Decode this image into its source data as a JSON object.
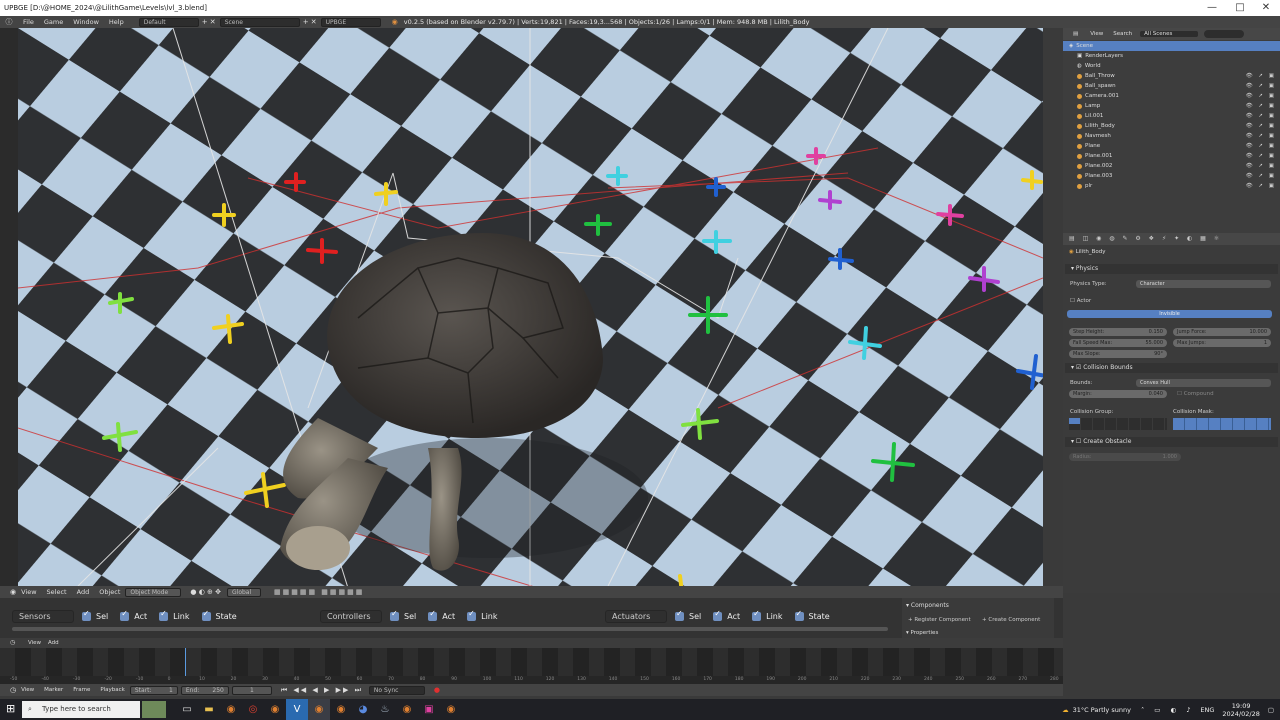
{
  "window": {
    "title": "UPBGE [D:\\@HOME_2024\\@LilithGame\\Levels\\lvl_3.blend]",
    "controls": [
      "—",
      "□",
      "✕"
    ]
  },
  "menubar": {
    "items": [
      "File",
      "Game",
      "Window",
      "Help"
    ],
    "layout_field": "Default",
    "scene_field": "Scene",
    "engine_field": "UPBGE",
    "stats": "v0.2.5 (based on Blender v2.79.7) | Verts:19,821 | Faces:19,3...568 | Objects:1/26 | Lamps:0/1 | Mem: 948.8 MB | Lilith_Body"
  },
  "outliner": {
    "header": [
      "View",
      "Search",
      "All Scenes"
    ],
    "rows": [
      {
        "label": "Scene",
        "selected": true
      },
      {
        "label": "RenderLayers"
      },
      {
        "label": "World"
      },
      {
        "label": "Ball_Throw"
      },
      {
        "label": "Ball_spawn"
      },
      {
        "label": "Camera.001"
      },
      {
        "label": "Lamp"
      },
      {
        "label": "Lil.001"
      },
      {
        "label": "Lilith_Body"
      },
      {
        "label": "Navmesh"
      },
      {
        "label": "Plane"
      },
      {
        "label": "Plane.001"
      },
      {
        "label": "Plane.002"
      },
      {
        "label": "Plane.003"
      },
      {
        "label": "plr"
      }
    ]
  },
  "properties": {
    "object_name": "Lilith_Body",
    "physics_header": "Physics",
    "physics_type_label": "Physics Type:",
    "physics_type_value": "Character",
    "actor_label": "Actor",
    "invisible_label": "Invisible",
    "step_height_label": "Step Height:",
    "step_height_value": "0.150",
    "jump_force_label": "Jump Force:",
    "jump_force_value": "10.000",
    "fall_speed_label": "Fall Speed Max:",
    "fall_speed_value": "55.000",
    "max_jumps_label": "Max Jumps:",
    "max_jumps_value": "1",
    "max_slope_label": "Max Slope:",
    "max_slope_value": "90°",
    "collision_bounds_header": "Collision Bounds",
    "bounds_label": "Bounds:",
    "bounds_value": "Convex Hull",
    "margin_label": "Margin:",
    "margin_value": "0.040",
    "compound_label": "Compound",
    "collision_group_label": "Collision Group:",
    "collision_mask_label": "Collision Mask:",
    "create_obstacle_header": "Create Obstacle",
    "radius_label": "Radius:",
    "radius_value": "1.000"
  },
  "viewport_header": {
    "items": [
      "View",
      "Select",
      "Add",
      "Object"
    ],
    "mode": "Object Mode",
    "orientation": "Global"
  },
  "logic": {
    "sensors": "Sensors",
    "controllers": "Controllers",
    "actuators": "Actuators",
    "sel": "Sel",
    "act": "Act",
    "link": "Link",
    "state": "State",
    "components_header": "Components",
    "register_component": "Register Component",
    "create_component": "Create Component",
    "properties_header": "Properties"
  },
  "timeline": {
    "header": [
      "View",
      "Add"
    ],
    "ticks": [
      "-50",
      "-40",
      "-30",
      "-20",
      "-10",
      "0",
      "10",
      "20",
      "30",
      "40",
      "50",
      "60",
      "70",
      "80",
      "90",
      "100",
      "110",
      "120",
      "130",
      "140",
      "150",
      "160",
      "170",
      "180",
      "190",
      "200",
      "210",
      "220",
      "230",
      "240",
      "250",
      "260",
      "270",
      "280"
    ],
    "controls": [
      "View",
      "Marker",
      "Frame",
      "Playback"
    ],
    "start_label": "Start:",
    "start_value": "1",
    "end_label": "End:",
    "end_value": "250",
    "current_frame": "1",
    "sync": "No Sync"
  },
  "taskbar": {
    "search_placeholder": "Type here to search",
    "weather": "31°C  Partly sunny",
    "lang": "ENG",
    "time": "19:09",
    "date": "2024/02/28"
  },
  "colors": {
    "accent": "#5680c2",
    "viewport_dark": "#2e3033",
    "viewport_light": "#b9cde0"
  }
}
